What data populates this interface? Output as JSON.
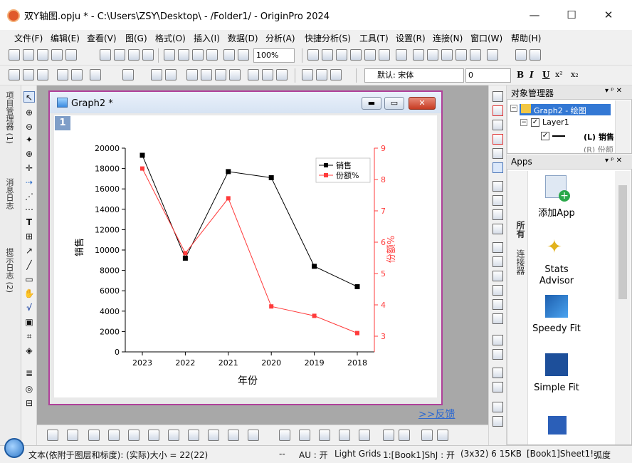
{
  "window": {
    "title": "双Y轴图.opju * - C:\\Users\\ZSY\\Desktop\\ - /Folder1/ - OriginPro 2024",
    "minimize": "—",
    "maximize": "☐",
    "close": "✕"
  },
  "menu": [
    "文件(F)",
    "编辑(E)",
    "查看(V)",
    "图(G)",
    "格式(O)",
    "插入(I)",
    "数据(D)",
    "分析(A)",
    "快捷分析(S)",
    "工具(T)",
    "设置(R)",
    "连接(N)",
    "窗口(W)",
    "帮助(H)"
  ],
  "toolbar": {
    "zoom": "100%",
    "font_name": "默认: 宋体",
    "font_size": "0",
    "format_buttons": [
      "B",
      "I",
      "U",
      "x²",
      "x₂"
    ]
  },
  "left_tabs": [
    "项目管理器 (1)",
    "消息日志",
    "提示日志 (2)"
  ],
  "graph": {
    "window_title": "Graph2 *",
    "layer_number": "1",
    "feedback_link": ">>反馈"
  },
  "chart_data": {
    "type": "line",
    "categories": [
      "2023",
      "2022",
      "2021",
      "2020",
      "2019",
      "2018"
    ],
    "xlabel": "年份",
    "ylabel_left": "销售",
    "ylabel_right": "份额%",
    "ylim_left": [
      0,
      20000
    ],
    "ylim_right": [
      2.5,
      9
    ],
    "yticks_left": [
      "0",
      "2000",
      "4000",
      "6000",
      "8000",
      "10000",
      "12000",
      "14000",
      "16000",
      "18000",
      "20000"
    ],
    "yticks_right": [
      "3",
      "4",
      "5",
      "6",
      "7",
      "8",
      "9"
    ],
    "legend_position": "top-right",
    "series": [
      {
        "name": "销售",
        "axis": "left",
        "color": "#000000",
        "values": [
          19300,
          9200,
          17700,
          17100,
          8400,
          6400
        ]
      },
      {
        "name": "份额%",
        "axis": "right",
        "color": "#ff3b3b",
        "values": [
          8.35,
          5.65,
          7.4,
          3.95,
          3.65,
          3.1
        ]
      }
    ]
  },
  "object_manager": {
    "title": "对象管理器",
    "items": [
      "Graph2 - 绘图",
      "Layer1",
      "(L) 销售",
      "(R) 份额"
    ]
  },
  "apps": {
    "title": "Apps",
    "tabs": [
      "所有",
      "连接器"
    ],
    "items": [
      "添加App",
      "Stats\nAdvisor",
      "Speedy Fit",
      "Simple Fit"
    ]
  },
  "status": {
    "left": "文本(依附于图层和标度): (实际)大小 = 22(22)",
    "dashes": "--",
    "au": "AU : 开",
    "grids": "Light Grids",
    "book": "1:[Book1]Sh​J : 开",
    "size": "(3x32) 6 15KB",
    "sheet": "[Book1]Sheet1!",
    "angle": "弧度"
  }
}
